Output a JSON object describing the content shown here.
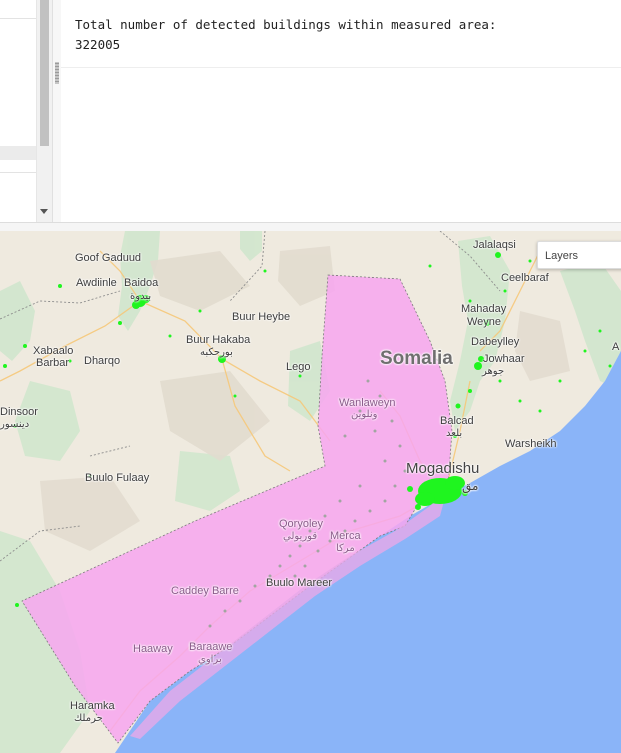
{
  "console": {
    "line1": "Total number of detected buildings within measured area:",
    "line2": "322005"
  },
  "map": {
    "layers_button": "Layers",
    "colors": {
      "land": "#efeadf",
      "vegetation": "#cfe6cd",
      "water": "#8ab4f8",
      "measured_area": "#f7a6f0",
      "buildings": "#1ff51f"
    },
    "places": {
      "goof_gaduud": "Goof Gaduud",
      "awdiinle": "Awdiinle",
      "baidoa": "Baidoa",
      "baidoa_ar": "بيدوة",
      "jalalaqsi": "Jalalaqsi",
      "ceelbaraf": "Ceelbaraf",
      "buur_heybe": "Buur Heybe",
      "buur_hakaba": "Buur Hakaba",
      "buur_hakaba_ar": "بورحكبه",
      "mahaday": "Mahaday",
      "weyne": "Weyne",
      "dabeylley": "Dabeylley",
      "jowhaar": "Jowhaar",
      "jowhaar_ar": "جوهر",
      "xabaalo": "Xabaalo",
      "barbar": "Barbar",
      "dharqo": "Dharqo",
      "lego": "Lego",
      "somalia": "Somalia",
      "wanlaweyn": "Wanlaweyn",
      "wanlaweyn_ar": "ونلوين",
      "dinsoor": "Dinsoor",
      "dinsoor_ar": "دينسور",
      "balcad": "Balcad",
      "balcad_ar": "بلعد",
      "warsheikh": "Warsheikh",
      "buulo_fulaay": "Buulo Fulaay",
      "mogadishu": "Mogadishu",
      "mogadishu_ar": "مق",
      "qoryoley": "Qoryoley",
      "qoryoley_ar": "قوريولي",
      "merca": "Merca",
      "merca_ar": "مركا",
      "buulo_mareer": "Buulo Mareer",
      "caddey_barre": "Caddey Barre",
      "haaway": "Haaway",
      "baraawe": "Baraawe",
      "baraawe_ar": "براوي",
      "haramka": "Haramka",
      "haramka_ar": "حرملك",
      "edge_a": "A"
    }
  }
}
